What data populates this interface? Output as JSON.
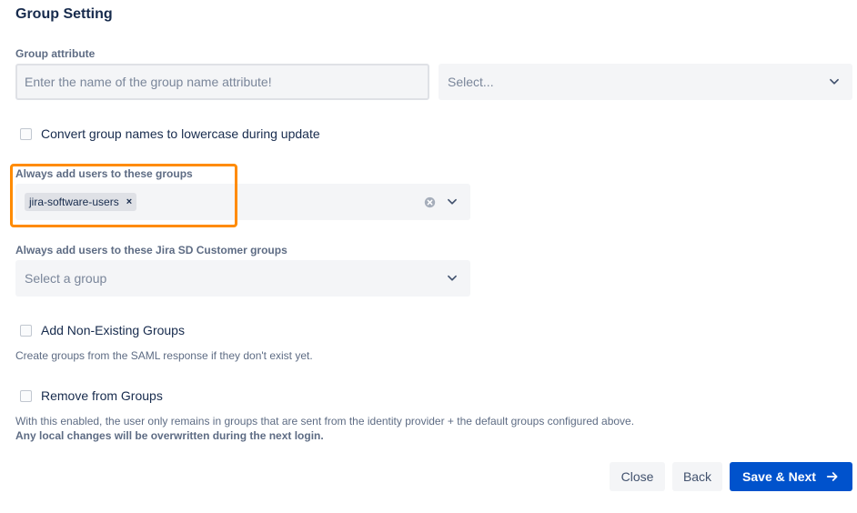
{
  "section": {
    "title": "Group Setting"
  },
  "group_attribute": {
    "label": "Group attribute",
    "input_placeholder": "Enter the name of the group name attribute!",
    "select_placeholder": "Select..."
  },
  "lowercase_option": {
    "label": "Convert group names to lowercase during update",
    "checked": false
  },
  "default_groups": {
    "label": "Always add users to these groups",
    "tags": [
      "jira-software-users"
    ],
    "remove_glyph": "×"
  },
  "sd_customer_groups": {
    "label": "Always add users to these Jira SD Customer groups",
    "placeholder": "Select a group"
  },
  "add_non_existing": {
    "label": "Add Non-Existing Groups",
    "checked": false,
    "help": "Create groups from the SAML response if they don't exist yet."
  },
  "remove_from_groups": {
    "label": "Remove from Groups",
    "checked": false,
    "help_line1": "With this enabled, the user only remains in groups that are sent from the identity provider + the default groups configured above.",
    "help_line2": "Any local changes will be overwritten during the next login."
  },
  "footer": {
    "close_label": "Close",
    "back_label": "Back",
    "save_next_label": "Save & Next"
  },
  "colors": {
    "primary": "#0052cc",
    "highlight": "#ff8b00",
    "field_bg": "#f4f5f7"
  },
  "icons": [
    "chevron-down-icon",
    "clear-icon",
    "arrow-right-icon"
  ]
}
